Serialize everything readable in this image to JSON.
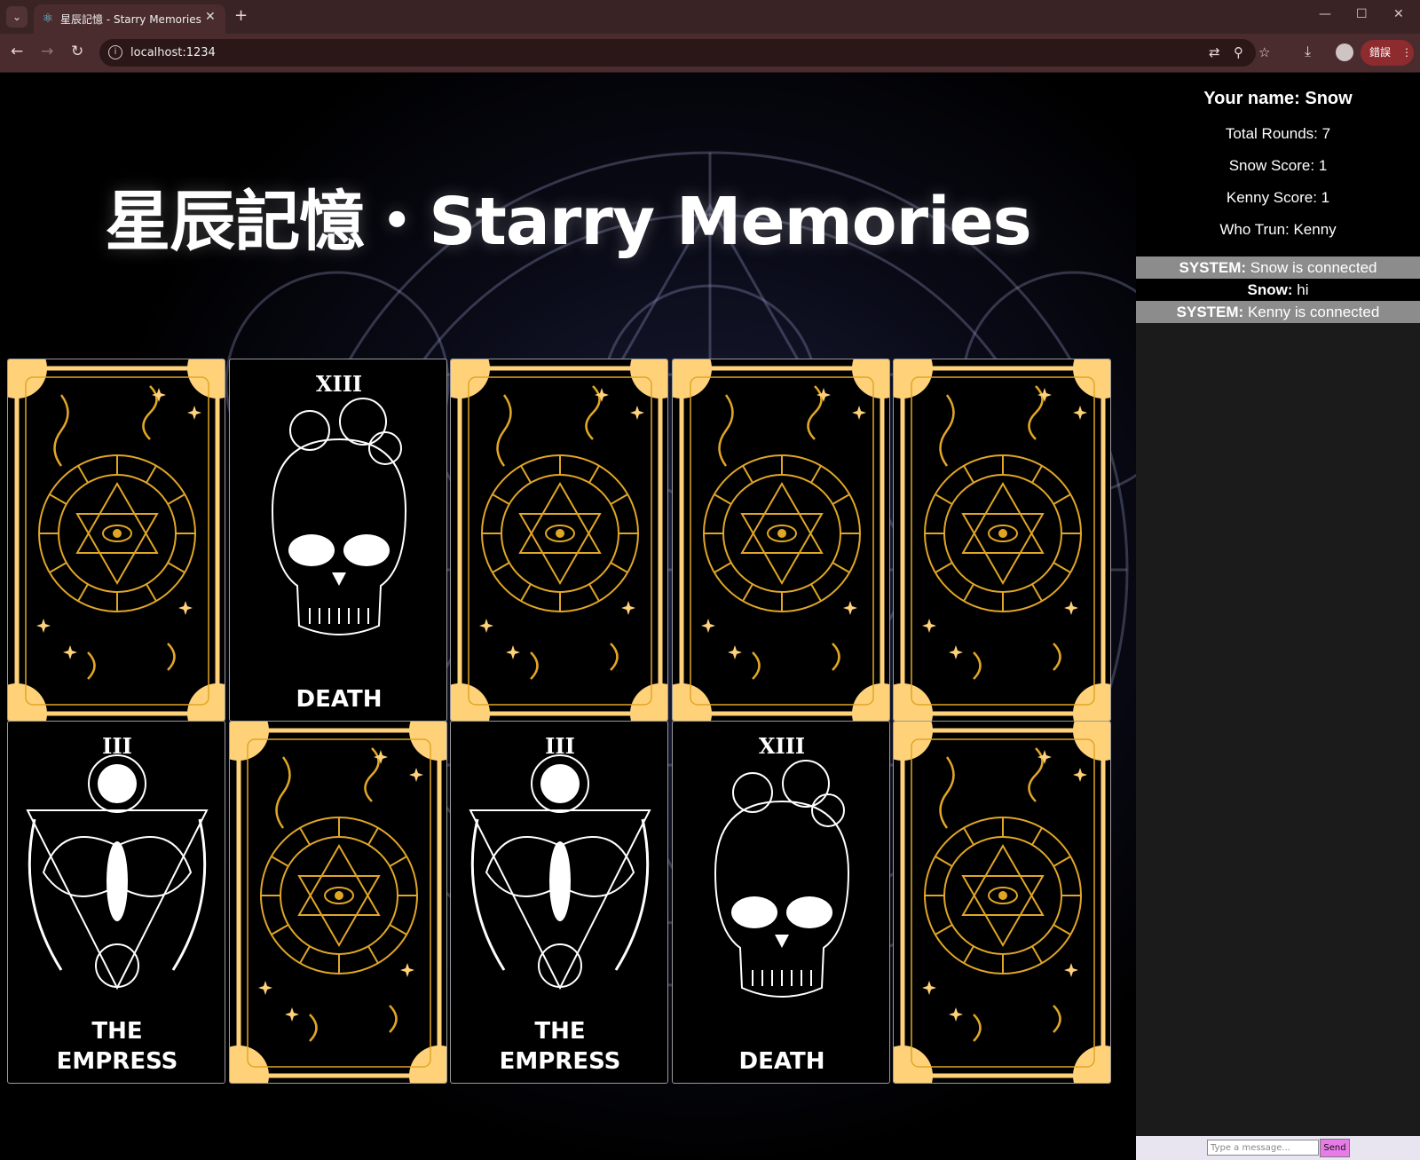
{
  "browser": {
    "tab_title": "星辰記憶 - Starry Memories",
    "url": "localhost:1234",
    "profile_status": "錯誤"
  },
  "page": {
    "title": "星辰記憶・Starry Memories"
  },
  "cards": [
    {
      "face": "back"
    },
    {
      "face": "front",
      "numeral": "XIII",
      "name": "DEATH"
    },
    {
      "face": "back"
    },
    {
      "face": "back"
    },
    {
      "face": "back"
    },
    {
      "face": "front",
      "numeral": "III",
      "name": "THE EMPRESS"
    },
    {
      "face": "back"
    },
    {
      "face": "front",
      "numeral": "III",
      "name": "THE EMPRESS"
    },
    {
      "face": "front",
      "numeral": "XIII",
      "name": "DEATH"
    },
    {
      "face": "back"
    }
  ],
  "scoreboard": {
    "your_name": "Your name: Snow",
    "total_rounds": "Total Rounds: 7",
    "snow_score": "Snow Score: 1",
    "kenny_score": "Kenny Score: 1",
    "who_turn": "Who Trun: Kenny"
  },
  "chat": {
    "messages": [
      {
        "sender": "SYSTEM:",
        "text": " Snow is connected",
        "type": "system"
      },
      {
        "sender": "Snow:",
        "text": " hi",
        "type": "user"
      },
      {
        "sender": "SYSTEM:",
        "text": " Kenny is connected",
        "type": "system"
      }
    ],
    "input_placeholder": "Type a message...",
    "send_label": "Send"
  },
  "colors": {
    "gold": "#e0a626",
    "gold_light": "#ffd27a",
    "tab_bar": "#3a2324",
    "toolbar": "#4b2c2e",
    "send_button": "#e77be8",
    "system_row": "#8c8c8c"
  }
}
